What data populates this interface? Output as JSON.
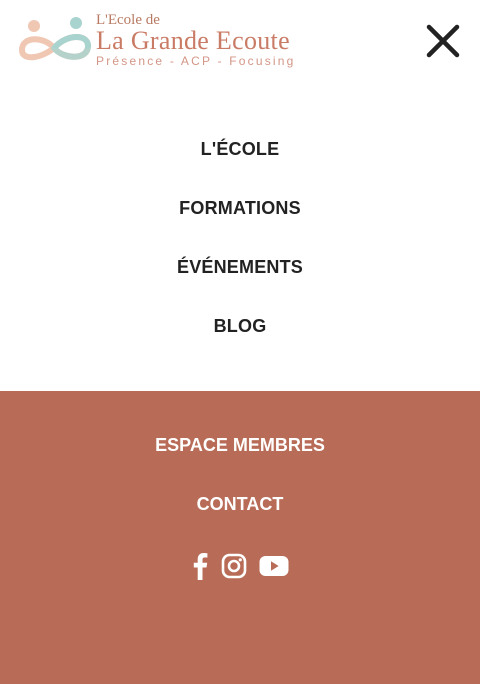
{
  "header": {
    "logo": {
      "small_text": "L'Ecole de",
      "title": "La Grande Ecoute",
      "subtitle": "Présence - ACP - Focusing",
      "mark_icon": "linked-figures-logo-icon",
      "colors": {
        "peach": "#f0c7b2",
        "teal": "#a9d3ce",
        "terracotta": "#c97b66"
      }
    },
    "close_icon": "close-icon"
  },
  "menu": {
    "items": [
      {
        "label": "L'ÉCOLE"
      },
      {
        "label": "FORMATIONS"
      },
      {
        "label": "ÉVÉNEMENTS"
      },
      {
        "label": "BLOG"
      }
    ]
  },
  "footer": {
    "background": "#b86b56",
    "items": [
      {
        "label": "ESPACE MEMBRES"
      },
      {
        "label": "CONTACT"
      }
    ],
    "social_icons": [
      "facebook-icon",
      "instagram-icon",
      "youtube-icon"
    ]
  }
}
